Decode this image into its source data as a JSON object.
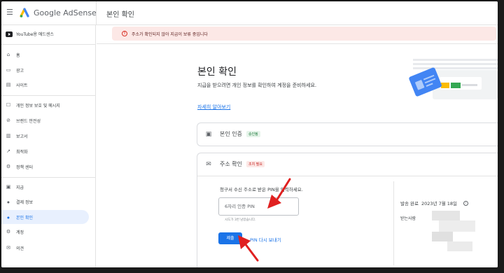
{
  "header": {
    "brand": "Google AdSense",
    "page_title": "본인 확인"
  },
  "sidebar": {
    "account": "YouTube용 애드센스",
    "items": [
      {
        "label": "홈",
        "icon": "home-icon",
        "glyph": "⌂"
      },
      {
        "label": "광고",
        "icon": "ads-icon",
        "glyph": "▭"
      },
      {
        "label": "사이트",
        "icon": "sites-icon",
        "glyph": "▤"
      },
      {
        "label": "개인 정보 보호 및 메시지",
        "icon": "privacy-icon",
        "glyph": "☐"
      },
      {
        "label": "브랜드 안전성",
        "icon": "brand-safety-icon",
        "glyph": "⊘"
      },
      {
        "label": "보고서",
        "icon": "reports-icon",
        "glyph": "▥"
      },
      {
        "label": "최적화",
        "icon": "optimization-icon",
        "glyph": "↗"
      },
      {
        "label": "정책 센터",
        "icon": "policy-icon",
        "glyph": "⚙"
      },
      {
        "label": "지급",
        "icon": "payments-icon",
        "glyph": "▣"
      },
      {
        "label": "결제 정보",
        "icon": "dot-icon",
        "glyph": "●"
      },
      {
        "label": "본인 확인",
        "icon": "dot-icon",
        "glyph": "●"
      },
      {
        "label": "계정",
        "icon": "account-icon",
        "glyph": "⚙"
      },
      {
        "label": "의견",
        "icon": "feedback-icon",
        "glyph": "✉"
      }
    ]
  },
  "alert": {
    "text": "주소가 확인되지 않아 지급이 보류 중입니다"
  },
  "page": {
    "title": "본인 확인",
    "description": "지급을 받으려면 개인 정보를 확인하여 계정을 준비하세요.",
    "learn_more": "자세히 알아보기"
  },
  "identity_card": {
    "title": "본인 인증",
    "badge": "승인됨"
  },
  "address_card": {
    "title": "주소 확인",
    "badge": "조치 필요",
    "prompt": "청구서 수신 주소로 받은 PIN을 입력하세요.",
    "pin_placeholder": "6자리 인증 PIN",
    "hint": "시도가 3번 남았습니다.",
    "submit": "제출",
    "resend": "PIN 다시 보내기",
    "sent_label": "발송 완료",
    "sent_date": "2023년 7월 18일",
    "recipient_label": "받는사람"
  },
  "colors": {
    "accent": "#1a73e8",
    "alert_bg": "#fce8e6",
    "arrow": "#e02020"
  }
}
